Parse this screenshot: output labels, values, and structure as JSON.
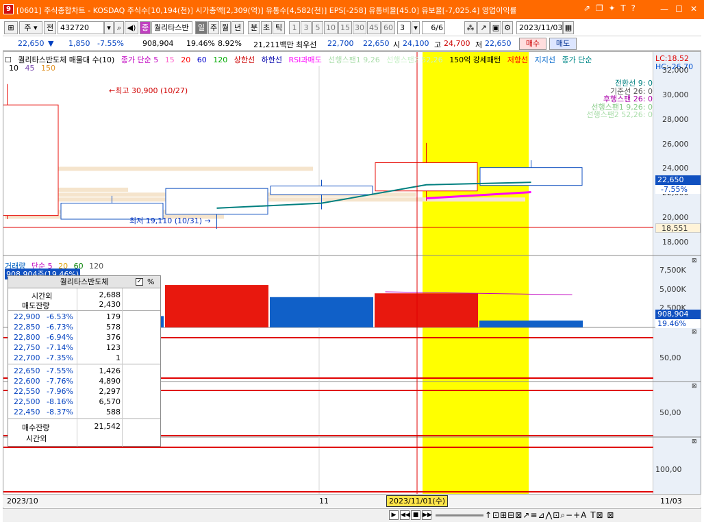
{
  "window": {
    "app_icon": "9",
    "title": "[0601] 주식종합차트 - KOSDAQ 주식수[10,194(천)] 시가총액[2,309(억)] 유통수[4,582(천)] EPS[-258] 유통비율[45.0] 유보율[-7,025.4] 영업이익률",
    "tb_icons": [
      "link-icon",
      "window-icon",
      "pin-icon",
      "text-icon",
      "help-icon"
    ],
    "tb_glyphs": [
      "⇗",
      "❐",
      "✦",
      "T",
      "?"
    ]
  },
  "toolbar": {
    "code_label": "주",
    "prev_label": "전",
    "code_value": "432720",
    "stock_badge": "종",
    "stock_name": "퀄리타스반",
    "periods": [
      "일",
      "주",
      "월",
      "년",
      "분",
      "초",
      "틱"
    ],
    "intervals": [
      "1",
      "3",
      "5",
      "10",
      "15",
      "30",
      "45",
      "60"
    ],
    "custom_interval": "3",
    "page": "6",
    "page_total": "/6",
    "date": "2023/11/03"
  },
  "info": {
    "price": "22,650",
    "arrow": "▼",
    "change": "1,850",
    "change_pct": "-7.55%",
    "volume": "908,904",
    "vol_ratio": "19.46%",
    "turnover": "8.92%",
    "amount": "21,211백만",
    "best_ask_label": "최우선",
    "best_ask": "22,700",
    "best_bid": "22,650",
    "open_label": "시",
    "open": "24,100",
    "high_label": "고",
    "high": "24,700",
    "low_label": "저",
    "low": "22,650",
    "buy_label": "매수",
    "sell_label": "매도"
  },
  "legend": {
    "items": [
      {
        "text": "퀄리타스반도체 매물대 수(10)",
        "color": "#000000"
      },
      {
        "text": "종가 단순 5",
        "color": "#c000c0"
      },
      {
        "text": "15",
        "color": "#ff66cc"
      },
      {
        "text": "20",
        "color": "#ff0000"
      },
      {
        "text": "60",
        "color": "#0000cc"
      },
      {
        "text": "120",
        "color": "#00aa00"
      },
      {
        "text": "상한선",
        "color": "#cc0000"
      },
      {
        "text": "하한선",
        "color": "#0000aa"
      },
      {
        "text": "RSI과매도",
        "color": "#ff00ff"
      },
      {
        "text": "선행스팬1 9,26",
        "color": "#aaddaa"
      },
      {
        "text": "선행스팬2 52,26",
        "color": "#c8f0c8"
      },
      {
        "text": "150억 강세패턴",
        "color": "#000000"
      },
      {
        "text": "저항선",
        "color": "#ff0000"
      },
      {
        "text": "지지선",
        "color": "#0066cc"
      },
      {
        "text": "종가 단순",
        "color": "#008888"
      }
    ],
    "line2": [
      "10",
      "45",
      "150"
    ],
    "line2_colors": [
      "#000000",
      "#7a4ab0",
      "#e09020"
    ],
    "lc": "LC:18.52",
    "hc": "HC:-26.70"
  },
  "ichimoku": [
    {
      "text": "전환선 9: 0",
      "color": "#008080"
    },
    {
      "text": "기준선 26: 0",
      "color": "#555555"
    },
    {
      "text": "후행스팬 26: 0",
      "color": "#aa00aa"
    },
    {
      "text": "선행스팬1 9,26: 0",
      "color": "#88cc88"
    },
    {
      "text": "선행스팬2 52,26: 0",
      "color": "#aaddaa"
    }
  ],
  "annotations": {
    "high": "←최고 30,900 (10/27)",
    "low": "최저 19,110 (10/31) →",
    "last_price": "22,650",
    "last_pct": "-7.55%",
    "ref_price": "18,551"
  },
  "chart_data": [
    {
      "type": "candlestick",
      "title": "",
      "x": [
        "10/27",
        "10/30",
        "10/31",
        "11/01",
        "11/02",
        "11/03"
      ],
      "open": [
        20200,
        21200,
        22400,
        22600,
        22200,
        24100
      ],
      "high": [
        30900,
        21800,
        22400,
        23100,
        26100,
        24700
      ],
      "low": [
        19900,
        19900,
        19110,
        20700,
        21400,
        22650
      ],
      "close": [
        29200,
        19900,
        20300,
        21900,
        24500,
        22650
      ],
      "colors": {
        "up": "#e8100b",
        "down": "#1050c0"
      },
      "ylim": [
        17000,
        32500
      ],
      "y_ticks": [
        "32,000",
        "30,000",
        "28,000",
        "26,000",
        "24,000",
        "22,000",
        "20,000",
        "18,000"
      ],
      "ma_lines": [
        {
          "name": "종가 단순 5",
          "color": "#007f7f",
          "x": [
            "10/31",
            "11/01",
            "11/02",
            "11/03"
          ],
          "values": [
            20800,
            21200,
            22700,
            22900
          ]
        },
        {
          "name": "후행스팬",
          "color": "#ff00ff",
          "x": [
            "11/02",
            "11/03"
          ],
          "values": [
            21600,
            22100
          ]
        }
      ],
      "volume_profile_levels": [
        24000,
        22300,
        21900,
        21500,
        20500,
        20100
      ],
      "highlight": "11/02",
      "crosshair_date": "2023/11/01(수)"
    },
    {
      "type": "bar",
      "title": "",
      "categories": [
        "10/30",
        "10/31",
        "11/01",
        "11/02",
        "11/03"
      ],
      "values": [
        1500000,
        5600000,
        4000000,
        4500000,
        908904
      ],
      "colors": [
        "#1060c8",
        "#e8180e",
        "#1060c8",
        "#e8180e",
        "#1060c8"
      ],
      "ylim": [
        0,
        8500000
      ],
      "y_ticks": [
        "7,500K",
        "5,000K",
        "2,500K"
      ],
      "ma_values": [
        4700000,
        4300000
      ],
      "legend": [
        "거래량",
        "단순 5",
        "20",
        "60",
        "120"
      ],
      "last_label": "908,904",
      "last_pct": "19.46%",
      "summary": "908,904주(19.46%)"
    }
  ],
  "lower_panels": [
    {
      "tick": "50,00"
    },
    {
      "tick": "50,00"
    },
    {
      "tick": "100,00"
    }
  ],
  "orderbook": {
    "title": "퀄리타스반도체",
    "pct_label": "%",
    "checked": "✓",
    "after_hours_label": "시간외",
    "after_hours_ask": "2,688",
    "ask_remain_label": "매도잔량",
    "ask_remain": "2,430",
    "asks": [
      {
        "price": "22,900",
        "pct": "-6.53%",
        "qty": "179"
      },
      {
        "price": "22,850",
        "pct": "-6.73%",
        "qty": "578"
      },
      {
        "price": "22,800",
        "pct": "-6.94%",
        "qty": "376"
      },
      {
        "price": "22,750",
        "pct": "-7.14%",
        "qty": "123"
      },
      {
        "price": "22,700",
        "pct": "-7.35%",
        "qty": "1"
      }
    ],
    "bids": [
      {
        "price": "22,650",
        "pct": "-7.55%",
        "qty": "1,426"
      },
      {
        "price": "22,600",
        "pct": "-7.76%",
        "qty": "4,890"
      },
      {
        "price": "22,550",
        "pct": "-7.96%",
        "qty": "2,297"
      },
      {
        "price": "22,500",
        "pct": "-8.16%",
        "qty": "6,570"
      },
      {
        "price": "22,450",
        "pct": "-8.37%",
        "qty": "588"
      }
    ],
    "bid_remain_label": "매수잔량",
    "bid_remain": "21,542",
    "after_hours_bid_label": "시간외"
  },
  "xaxis": {
    "start": "2023/10",
    "mid": "11",
    "current": "2023/11/01(수)",
    "end": "11/03"
  }
}
